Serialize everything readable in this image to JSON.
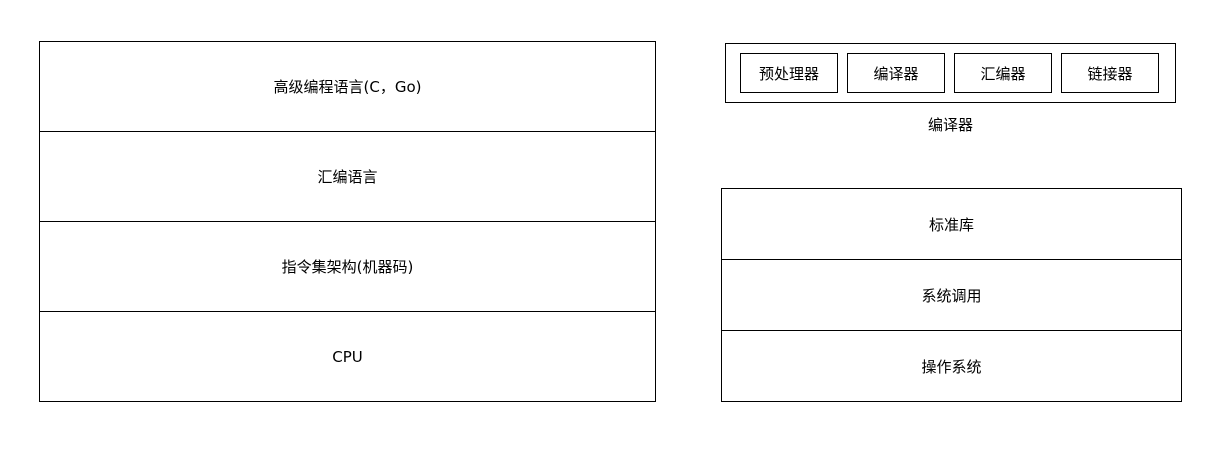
{
  "software_stack": {
    "layers": [
      "高级编程语言(C，Go)",
      "汇编语言",
      "指令集架构(机器码)",
      "CPU"
    ]
  },
  "compiler": {
    "stages": [
      "预处理器",
      "编译器",
      "汇编器",
      "链接器"
    ],
    "caption": "编译器"
  },
  "system_stack": {
    "layers": [
      "标准库",
      "系统调用",
      "操作系统"
    ]
  }
}
